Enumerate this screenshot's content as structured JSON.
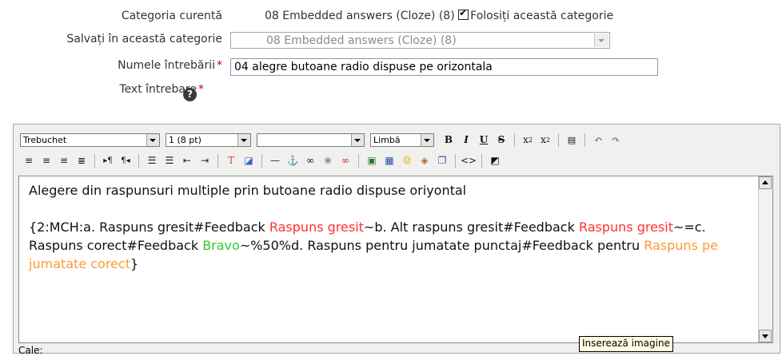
{
  "form": {
    "current_category_label": "Categoria curentă",
    "current_category_value": "08 Embedded answers (Cloze) (8)",
    "use_category_label": "Folosiți această categorie",
    "save_in_label": "Salvați în această categorie",
    "save_in_value": "08 Embedded answers (Cloze) (8)",
    "question_name_label": "Numele întrebării",
    "question_name_value": "04 alegre butoane radio dispuse pe orizontala",
    "question_text_label": "Text întrebare",
    "required_mark": "*",
    "help_glyph": "?"
  },
  "toolbar": {
    "font_family": "Trebuchet",
    "font_size": "1 (8 pt)",
    "format": "",
    "language": "Limbă",
    "bold": "B",
    "italic": "I",
    "underline": "U",
    "strike": "S"
  },
  "editor": {
    "line1": "Alegere din raspunsuri multiple prin butoane radio dispuse oriyontal",
    "p1": "{2:MCH:a. Raspuns gresit#Feedback ",
    "p1_red": "Raspuns gresit",
    "p2": "~b. Alt raspuns gresit#Feedback ",
    "p2_red": "Raspuns gresit",
    "p3": "~=c. Raspuns corect#Feedback ",
    "p3_green": "Bravo",
    "p4": "~%50%d. Raspuns pentru jumatate punctaj#Feedback pentru ",
    "p4_orange": "Raspuns pe jumatate corect",
    "p5": "}",
    "status_path": "Cale:",
    "tooltip": "Inserează imagine"
  },
  "colors": {
    "red": "#ff3030",
    "green": "#33cc33",
    "orange": "#ff9933"
  }
}
